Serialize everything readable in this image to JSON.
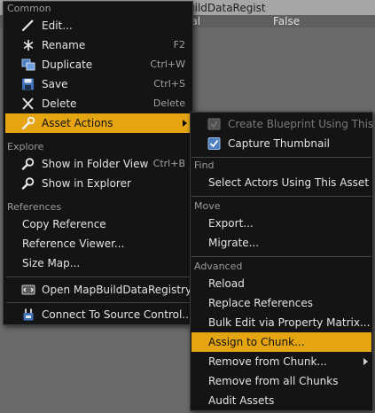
{
  "background": {
    "header_title": "uildDataRegist",
    "row_label": "ial",
    "row_value": "False"
  },
  "main_menu": {
    "sections": {
      "common": "Common",
      "explore": "Explore",
      "references": "References"
    },
    "items": {
      "edit": "Edit...",
      "rename": "Rename",
      "rename_shortcut": "F2",
      "duplicate": "Duplicate",
      "duplicate_shortcut": "Ctrl+W",
      "save": "Save",
      "save_shortcut": "Ctrl+S",
      "delete": "Delete",
      "delete_shortcut": "Delete",
      "asset_actions": "Asset Actions",
      "show_in_folder_view": "Show in Folder View",
      "show_in_folder_view_shortcut": "Ctrl+B",
      "show_in_explorer": "Show in Explorer",
      "copy_reference": "Copy Reference",
      "reference_viewer": "Reference Viewer...",
      "size_map": "Size Map...",
      "open_mapbuilddataregistry": "Open MapBuildDataRegistry.h",
      "connect_to_source_control": "Connect To Source Control..."
    }
  },
  "sub_menu": {
    "sections": {
      "find": "Find",
      "move": "Move",
      "advanced": "Advanced"
    },
    "items": {
      "create_blueprint": "Create Blueprint Using This...",
      "capture_thumbnail": "Capture Thumbnail",
      "select_actors": "Select Actors Using This Asset",
      "export": "Export...",
      "migrate": "Migrate...",
      "reload": "Reload",
      "replace_references": "Replace References",
      "bulk_edit": "Bulk Edit via Property Matrix...",
      "assign_to_chunk": "Assign to Chunk...",
      "remove_from_chunk": "Remove from Chunk...",
      "remove_from_all_chunks": "Remove from all Chunks",
      "audit_assets": "Audit Assets"
    }
  },
  "colors": {
    "highlight": "#e5a513",
    "menu_background": "#141414",
    "section_text": "#9a9a9a"
  },
  "icons": {
    "edit": "pencil-icon",
    "rename": "rename-icon",
    "duplicate": "duplicate-icon",
    "save": "floppy-disk-icon",
    "delete": "x-delete-icon",
    "asset_actions": "wrench-icon",
    "show_in_folder_view": "magnifier-icon",
    "show_in_explorer": "magnifier-icon",
    "open_source": "code-file-icon",
    "source_control": "source-control-icon",
    "create_blueprint": "blueprint-icon",
    "capture_thumbnail": "checkbox-checked-icon"
  }
}
